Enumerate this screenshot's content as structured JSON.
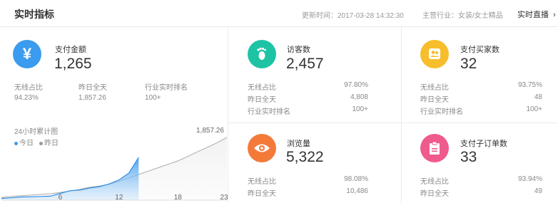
{
  "header": {
    "title": "实时指标",
    "update_text": "更新时间：2017-03-28 14:32:30",
    "industry_text": "主营行业：女装/女士精品",
    "live_link": "实时直播"
  },
  "payment": {
    "label": "支付金额",
    "value": "1,265",
    "icon": "yen-icon",
    "color": "#3a9bef",
    "stats": [
      {
        "label": "无线占比",
        "value": "94.23%"
      },
      {
        "label": "昨日全天",
        "value": "1,857.26"
      },
      {
        "label": "行业实时排名",
        "value": "100+"
      }
    ]
  },
  "visitors": {
    "label": "访客数",
    "value": "2,457",
    "icon": "footprint-icon",
    "color": "#1ec3a4",
    "stats": [
      {
        "label": "无线占比",
        "value": "97.80%"
      },
      {
        "label": "昨日全天",
        "value": "4,808"
      },
      {
        "label": "行业实时排名",
        "value": "100+"
      }
    ]
  },
  "buyers": {
    "label": "支付买家数",
    "value": "32",
    "icon": "users-icon",
    "color": "#f6be2c",
    "stats": [
      {
        "label": "无线占比",
        "value": "93.75%"
      },
      {
        "label": "昨日全天",
        "value": "48"
      },
      {
        "label": "行业实时排名",
        "value": "100+"
      }
    ]
  },
  "pageviews": {
    "label": "浏览量",
    "value": "5,322",
    "icon": "eye-icon",
    "color": "#f47a3a",
    "stats": [
      {
        "label": "无线占比",
        "value": "98.08%"
      },
      {
        "label": "昨日全天",
        "value": "10,486"
      }
    ]
  },
  "suborders": {
    "label": "支付子订单数",
    "value": "33",
    "icon": "clipboard-icon",
    "color": "#ef5b8c",
    "stats": [
      {
        "label": "无线占比",
        "value": "93.94%"
      },
      {
        "label": "昨日全天",
        "value": "49"
      }
    ]
  },
  "chart_data": {
    "type": "area",
    "title": "24小时累计图",
    "series": [
      {
        "name": "今日",
        "color": "#3a9bef",
        "x": [
          0,
          1,
          2,
          3,
          4,
          5,
          6,
          7,
          8,
          9,
          10,
          11,
          12,
          13,
          14
        ],
        "values": [
          50,
          70,
          95,
          100,
          110,
          118,
          200,
          280,
          300,
          360,
          400,
          480,
          600,
          800,
          1265
        ]
      },
      {
        "name": "昨日",
        "color": "#aaaaaa",
        "x": [
          0,
          1,
          2,
          3,
          4,
          5,
          6,
          7,
          8,
          9,
          10,
          11,
          12,
          13,
          14,
          15,
          16,
          17,
          18,
          19,
          20,
          21,
          22,
          23
        ],
        "values": [
          80,
          110,
          130,
          150,
          170,
          190,
          230,
          270,
          320,
          380,
          420,
          470,
          560,
          660,
          760,
          860,
          960,
          1060,
          1160,
          1290,
          1430,
          1560,
          1700,
          1857.26
        ]
      }
    ],
    "x_ticks": [
      "6",
      "12",
      "18",
      "23"
    ],
    "x_tick_values": [
      6,
      12,
      18,
      23
    ],
    "peak_label": "1,857.26",
    "xlim": [
      0,
      23
    ],
    "ylim": [
      0,
      2000
    ]
  }
}
